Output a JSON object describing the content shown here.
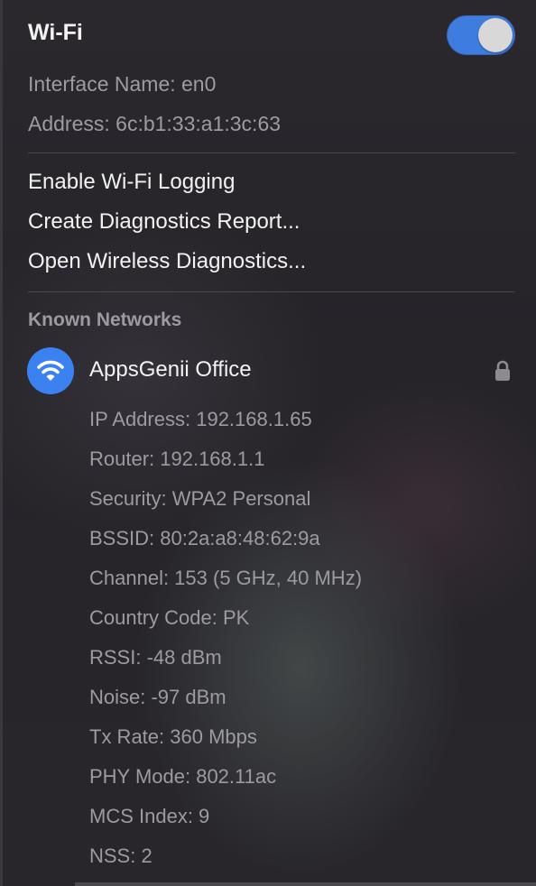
{
  "header": {
    "title": "Wi-Fi",
    "wifi_enabled": true
  },
  "interface": {
    "name": "Interface Name: en0",
    "address": "Address: 6c:b1:33:a1:3c:63"
  },
  "menu": {
    "items": [
      "Enable Wi-Fi Logging",
      "Create Diagnostics Report...",
      "Open Wireless Diagnostics..."
    ]
  },
  "known_networks": {
    "header": "Known Networks",
    "network": {
      "name": "AppsGenii Office",
      "icon": "wifi-icon",
      "locked": true,
      "details": [
        "IP Address: 192.168.1.65",
        "Router: 192.168.1.1",
        "Security: WPA2 Personal",
        "BSSID: 80:2a:a8:48:62:9a",
        "Channel: 153 (5 GHz, 40 MHz)",
        "Country Code: PK",
        "RSSI: -48 dBm",
        "Noise: -97 dBm",
        "Tx Rate: 360 Mbps",
        "PHY Mode: 802.11ac",
        "MCS Index: 9",
        "NSS: 2"
      ]
    }
  },
  "colors": {
    "accent": "#3b82f0",
    "toggle_on": "#3f7ce0",
    "text_primary": "#f2f2f2",
    "text_secondary": "#9d9ba1"
  }
}
